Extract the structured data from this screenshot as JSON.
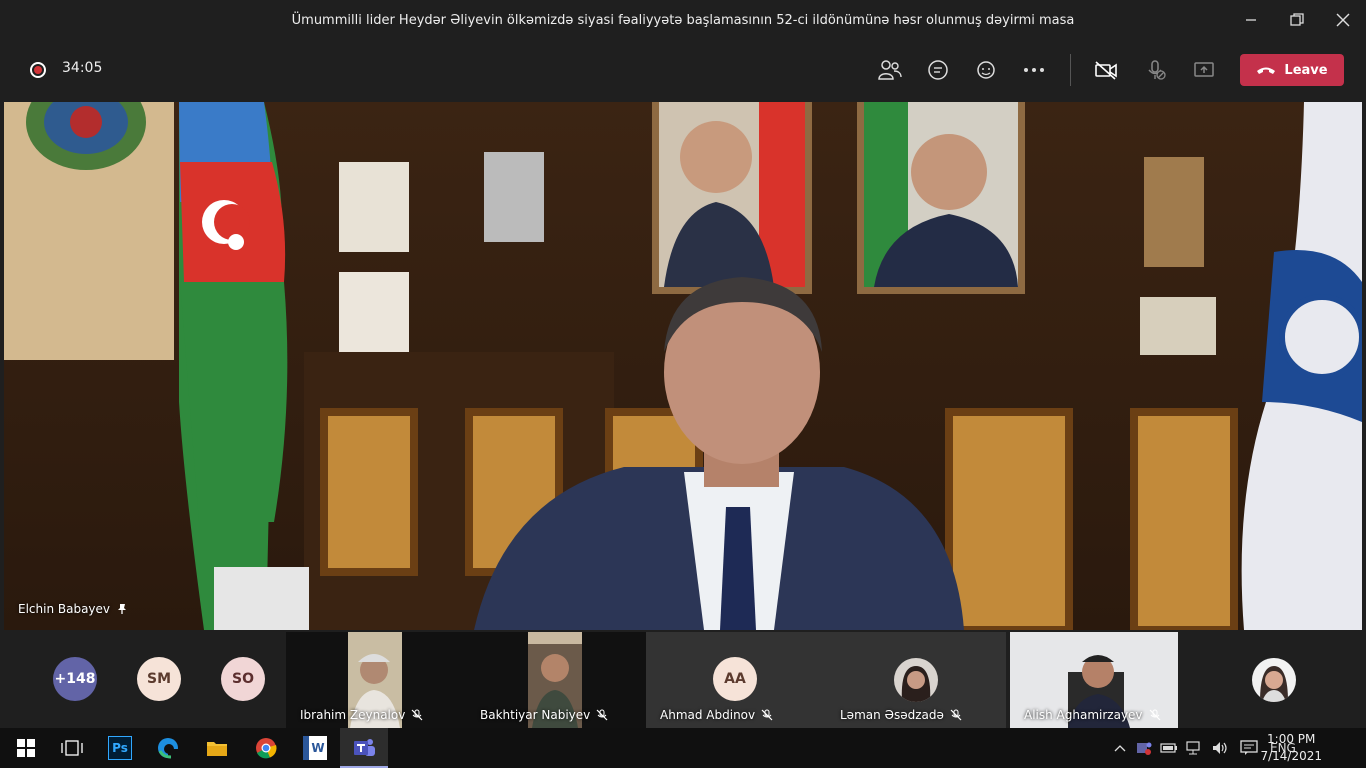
{
  "window": {
    "title": "Ümummilli lider Heydər Əliyevin ölkəmizdə siyasi fəaliyyətə başlamasının 52-ci ildönümünə həsr olunmuş dəyirmi masa"
  },
  "toolbar": {
    "timer": "34:05",
    "leave_label": "Leave"
  },
  "main_video": {
    "speaker_name": "Elchin Babayev"
  },
  "gallery": {
    "overflow": {
      "label": "+148",
      "color": "#6264a7"
    },
    "initials": [
      {
        "label": "SM",
        "color": "#f6e3d8",
        "text_color": "#5c3b2e"
      },
      {
        "label": "SO",
        "color": "#f1d6d6",
        "text_color": "#5c2e2e"
      }
    ],
    "tiles": [
      {
        "name": "Ibrahim Zeynalov"
      },
      {
        "name": "Bakhtiyar Nabiyev"
      },
      {
        "name": "Ahmad Abdinov",
        "initials": "AA"
      },
      {
        "name": "Ləman Əsədzadə"
      },
      {
        "name": "Alish Aghamirzayev"
      }
    ]
  },
  "taskbar": {
    "lang": "ENG",
    "time": "1:00 PM",
    "date": "7/14/2021",
    "apps": [
      "Ps",
      "W"
    ]
  }
}
